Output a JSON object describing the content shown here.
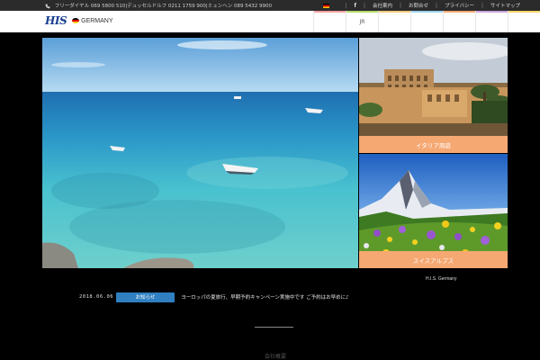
{
  "topbar": {
    "contact": "フリーダイヤル 069 5800 510|デュッセルドルフ 0211 1759 900|ミュンヘン 089 5432 9900",
    "facebook": "f",
    "links": [
      "会社案内",
      "お問合せ",
      "プライバシー",
      "サイトマップ"
    ]
  },
  "header": {
    "logo": "HIS",
    "country": "GERMANY",
    "nav": [
      {
        "label": "",
        "color": "#f2a0a0"
      },
      {
        "label": "JR",
        "color": "#b5d86a"
      },
      {
        "label": "",
        "color": "#f2c97e"
      },
      {
        "label": "",
        "color": "#9ed2ee"
      },
      {
        "label": "",
        "color": "#f5a872"
      },
      {
        "label": "",
        "color": "#c9a4dc"
      },
      {
        "label": "",
        "color": "#f4d36a"
      }
    ]
  },
  "cards": [
    {
      "label": "イタリア周遊"
    },
    {
      "label": "スイスアルプス"
    }
  ],
  "news": {
    "date": "2018.06.06",
    "button": "お知らせ",
    "text": "ヨーロッパの夏旅行、早期予約キャンペーン実施中です ご予約はお早めに♪"
  },
  "brand": "H.I.S. Germany",
  "footer": "会社概要",
  "colors": {
    "accent_blue": "#2f7fc1",
    "card_label": "#f5a872",
    "logo_blue": "#1b3f8f"
  }
}
